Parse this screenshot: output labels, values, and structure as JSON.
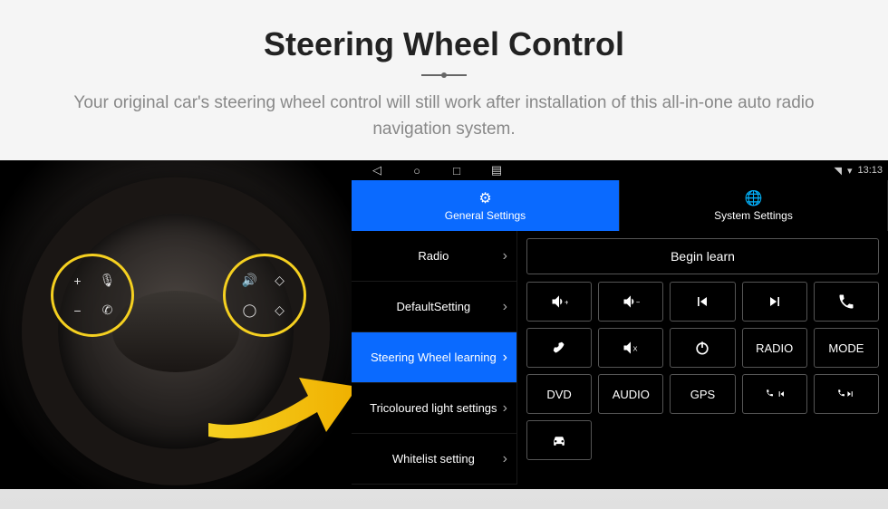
{
  "header": {
    "title": "Steering Wheel Control",
    "subtitle": "Your original car's steering wheel control will still work after installation of this all-in-one auto radio navigation system."
  },
  "statusbar": {
    "time": "13:13"
  },
  "tabs": [
    {
      "label": "General Settings",
      "active": true
    },
    {
      "label": "System Settings",
      "active": false
    }
  ],
  "sidemenu": [
    {
      "label": "Radio",
      "active": false
    },
    {
      "label": "DefaultSetting",
      "active": false
    },
    {
      "label": "Steering Wheel learning",
      "active": true
    },
    {
      "label": "Tricoloured light settings",
      "active": false
    },
    {
      "label": "Whitelist setting",
      "active": false
    }
  ],
  "main": {
    "begin": "Begin learn",
    "buttons": [
      {
        "name": "vol-up",
        "text": "",
        "icon": "vol-up"
      },
      {
        "name": "vol-down",
        "text": "",
        "icon": "vol-down"
      },
      {
        "name": "prev",
        "text": "",
        "icon": "prev"
      },
      {
        "name": "next",
        "text": "",
        "icon": "next"
      },
      {
        "name": "call",
        "text": "",
        "icon": "call"
      },
      {
        "name": "hangup",
        "text": "",
        "icon": "hangup"
      },
      {
        "name": "mute",
        "text": "",
        "icon": "mute"
      },
      {
        "name": "power",
        "text": "",
        "icon": "power"
      },
      {
        "name": "radio",
        "text": "RADIO",
        "icon": ""
      },
      {
        "name": "mode",
        "text": "MODE",
        "icon": ""
      },
      {
        "name": "dvd",
        "text": "DVD",
        "icon": ""
      },
      {
        "name": "audio",
        "text": "AUDIO",
        "icon": ""
      },
      {
        "name": "gps",
        "text": "GPS",
        "icon": ""
      },
      {
        "name": "call-prev",
        "text": "",
        "icon": "call-prev"
      },
      {
        "name": "call-next",
        "text": "",
        "icon": "call-next"
      },
      {
        "name": "car",
        "text": "",
        "icon": "car"
      }
    ]
  }
}
